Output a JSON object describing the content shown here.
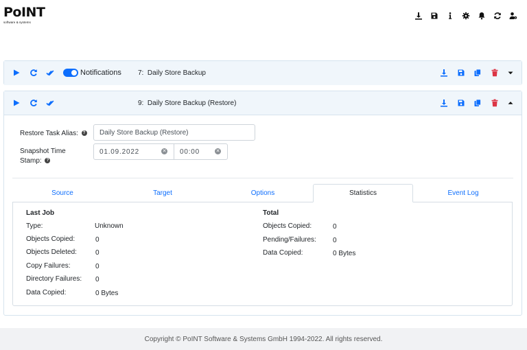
{
  "header": {
    "logo_text": "PoINT",
    "logo_subtitle": "software & systems",
    "icons": [
      "download-icon",
      "save-icon",
      "info-icon",
      "gear-icon",
      "bell-icon",
      "refresh-icon",
      "user-settings-icon"
    ]
  },
  "tasks": [
    {
      "id_label": "7:",
      "title": "Daily Store Backup",
      "notifications_label": "Notifications",
      "notifications_enabled": true,
      "expanded": false
    },
    {
      "id_label": "9:",
      "title": "Daily Store Backup (Restore)",
      "expanded": true,
      "form": {
        "alias_label": "Restore Task Alias:",
        "alias_value": "Daily Store Backup (Restore)",
        "snapshot_label_line1": "Snapshot Time",
        "snapshot_label_line2": "Stamp:",
        "date_value": "01.09.2022",
        "time_value": "00:00"
      },
      "tabs": [
        {
          "label": "Source",
          "active": false
        },
        {
          "label": "Target",
          "active": false
        },
        {
          "label": "Options",
          "active": false
        },
        {
          "label": "Statistics",
          "active": true
        },
        {
          "label": "Event Log",
          "active": false
        }
      ],
      "statistics": {
        "last_job": {
          "title": "Last Job",
          "rows": [
            {
              "label": "Type:",
              "value": "Unknown"
            },
            {
              "label": "Objects Copied:",
              "value": "0"
            },
            {
              "label": "Objects Deleted:",
              "value": "0"
            },
            {
              "label": "Copy Failures:",
              "value": "0"
            },
            {
              "label": "Directory Failures:",
              "value": "0"
            },
            {
              "label": "Data Copied:",
              "value": "0 Bytes"
            }
          ]
        },
        "total": {
          "title": "Total",
          "rows": [
            {
              "label": "Objects Copied:",
              "value": "0"
            },
            {
              "label": "Pending/Failures:",
              "value": "0"
            },
            {
              "label": "Data Copied:",
              "value": "0 Bytes"
            }
          ]
        }
      }
    }
  ],
  "colors": {
    "primary": "#0d6efd",
    "danger": "#dc3545",
    "card_header_bg": "#f0f6fb",
    "footer_bg": "#f1f2f4"
  },
  "footer": {
    "copyright": "Copyright © PoINT Software & Systems GmbH 1994-2022. All rights reserved."
  }
}
